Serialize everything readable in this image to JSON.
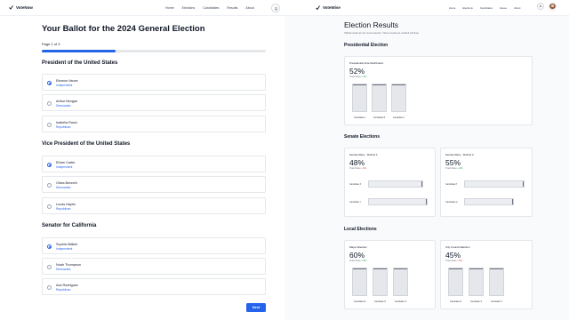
{
  "ballot_app": {
    "brand": "VoteNow",
    "nav": [
      "Home",
      "Elections",
      "Candidates",
      "Results",
      "About"
    ],
    "title": "Your Ballot for the 2024 General Election",
    "page_count": "Page 1 of 3",
    "progress": 0.33,
    "sections": [
      {
        "heading": "President of the United States",
        "options": [
          {
            "name": "Eleanor Vance",
            "party": "Independent",
            "selected": true
          },
          {
            "name": "Arthur Morgan",
            "party": "Democratic",
            "selected": false
          },
          {
            "name": "Isabella Rossi",
            "party": "Republican",
            "selected": false
          }
        ]
      },
      {
        "heading": "Vice President of the United States",
        "options": [
          {
            "name": "Ethan Carter",
            "party": "Independent",
            "selected": true
          },
          {
            "name": "Olivia Bennett",
            "party": "Democratic",
            "selected": false
          },
          {
            "name": "Lucas Hayes",
            "party": "Republican",
            "selected": false
          }
        ]
      },
      {
        "heading": "Senator for California",
        "options": [
          {
            "name": "Sophia Walker",
            "party": "Independent",
            "selected": true
          },
          {
            "name": "Noah Thompson",
            "party": "Democratic",
            "selected": false
          },
          {
            "name": "Ava Rodriguez",
            "party": "Republican",
            "selected": false
          }
        ]
      }
    ],
    "next_label": "Next",
    "accent": "#2563eb"
  },
  "results_app": {
    "brand": "VoteWise",
    "nav": [
      "Home",
      "Elections",
      "Candidates",
      "Issues",
      "About"
    ],
    "title": "Election Results",
    "subtitle": "Official results for the recent election. These results are certified and final.",
    "sections": {
      "presidential": {
        "heading": "Presidential Election",
        "cards": [
          {
            "title": "Presidential Vote Distribution",
            "pct": "52%",
            "sub_prefix": "Total Votes:",
            "change": "+2%",
            "change_sign": "pos",
            "bars": [
              {
                "label": "Candidate A",
                "value": 0.5
              },
              {
                "label": "Candidate B",
                "value": 0.35
              },
              {
                "label": "Candidate C",
                "value": 0.15
              }
            ]
          }
        ]
      },
      "senate": {
        "heading": "Senate Elections",
        "cards": [
          {
            "title": "Senate Race - District 1",
            "pct": "48%",
            "sub_prefix": "Total Votes:",
            "change": "-1%",
            "change_sign": "neg",
            "rows": [
              {
                "label": "Candidate X",
                "value": 0.48
              },
              {
                "label": "Candidate Y",
                "value": 0.52
              }
            ]
          },
          {
            "title": "Senate Race - District 2",
            "pct": "55%",
            "sub_prefix": "Total Votes:",
            "change": "+3%",
            "change_sign": "pos",
            "rows": [
              {
                "label": "Candidate P",
                "value": 0.55
              },
              {
                "label": "Candidate Q",
                "value": 0.45
              }
            ]
          }
        ]
      },
      "local": {
        "heading": "Local Elections",
        "cards": [
          {
            "title": "Mayor Election",
            "pct": "60%",
            "sub_prefix": "Total Votes:",
            "change": "+5%",
            "change_sign": "pos",
            "bars": [
              {
                "label": "Candidate M",
                "value": 0.6
              },
              {
                "label": "Candidate N",
                "value": 0.3
              },
              {
                "label": "Candidate O",
                "value": 0.1
              }
            ]
          },
          {
            "title": "City Council Election",
            "pct": "45%",
            "sub_prefix": "Total Votes:",
            "change": "-2%",
            "change_sign": "neg",
            "bars": [
              {
                "label": "Candidate R",
                "value": 0.45
              },
              {
                "label": "Candidate S",
                "value": 0.35
              },
              {
                "label": "Candidate T",
                "value": 0.2
              }
            ]
          }
        ]
      }
    }
  }
}
